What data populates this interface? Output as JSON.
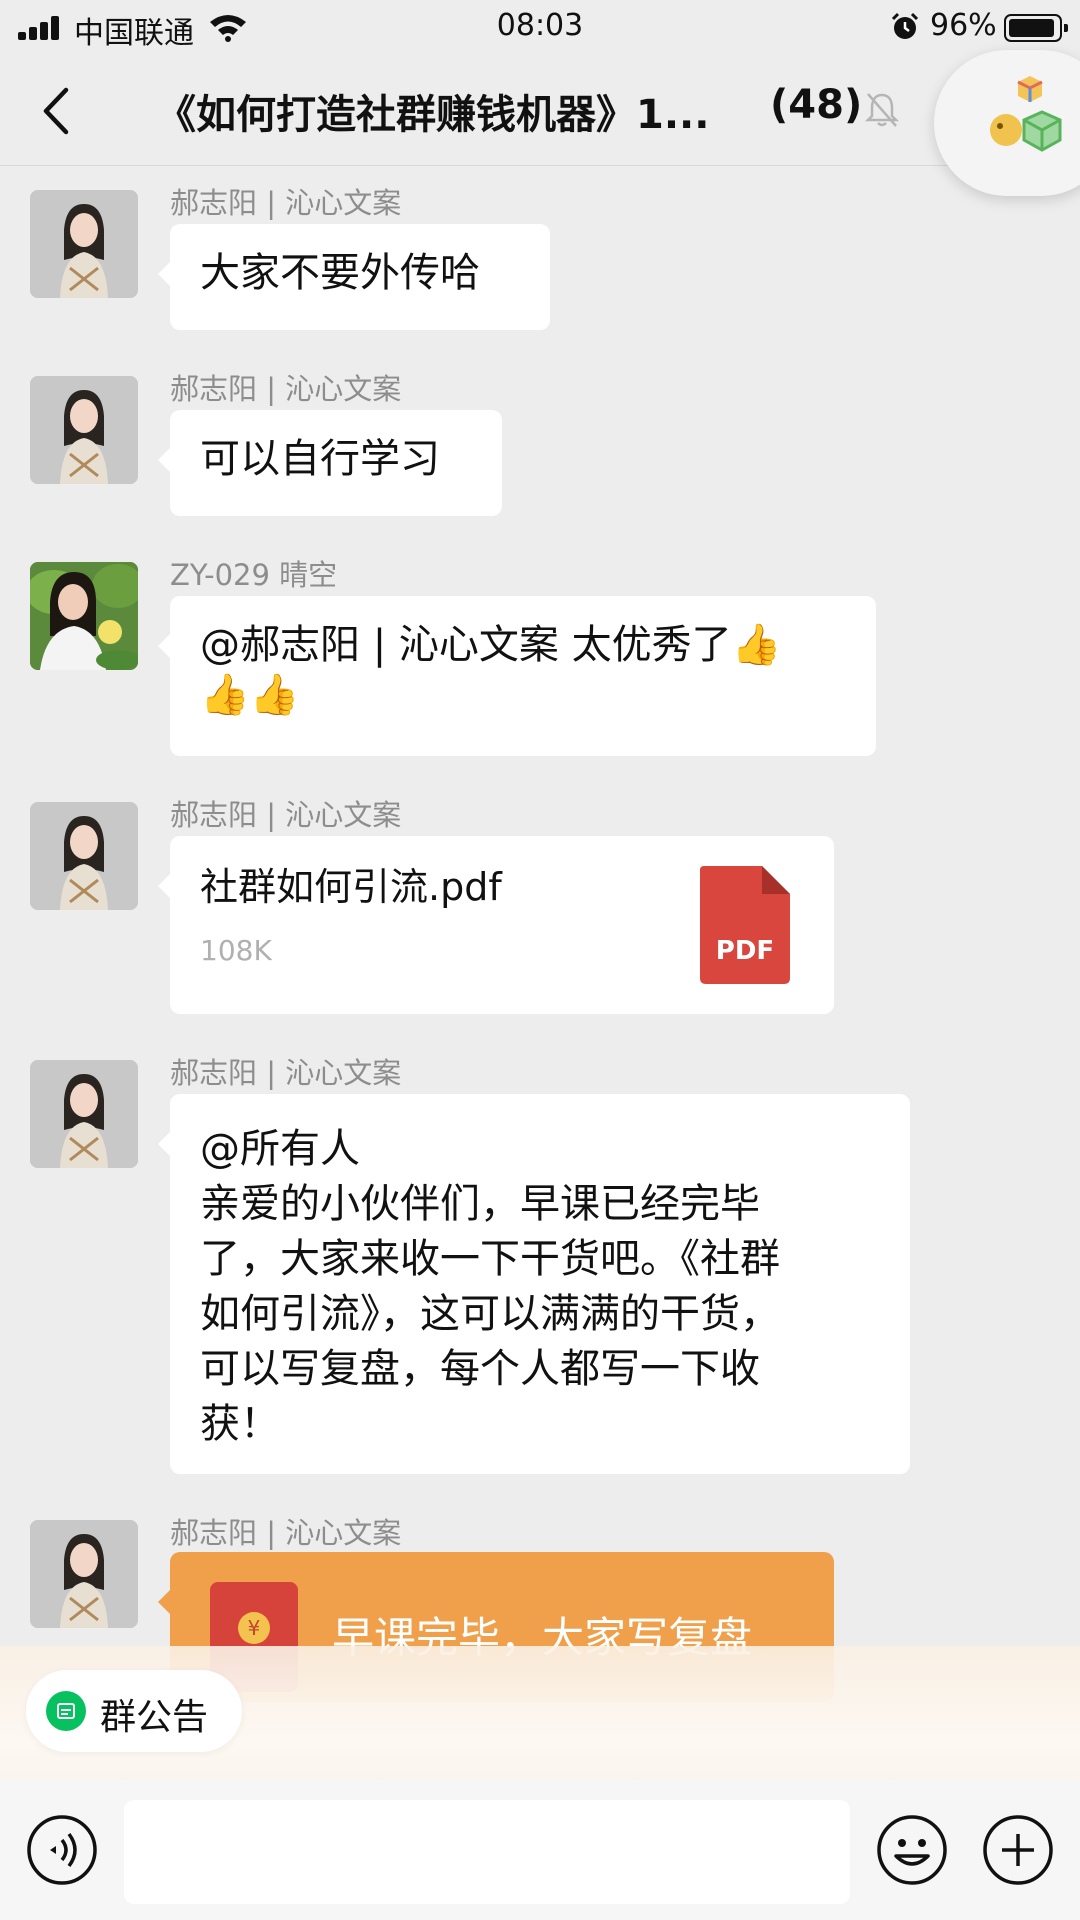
{
  "status_bar": {
    "carrier": "中国联通",
    "time": "08:03",
    "battery": "96%"
  },
  "nav": {
    "title": "《如何打造社群赚钱机器》1...",
    "member_count": "(48)"
  },
  "messages": [
    {
      "sender": "郝志阳 | 沁心文案",
      "text": "大家不要外传哈"
    },
    {
      "sender": "郝志阳 | 沁心文案",
      "text": "可以自行学习"
    },
    {
      "sender": "ZY-029 晴空",
      "text": "@郝志阳 | 沁心文案 太优秀了",
      "emoji": "👍"
    },
    {
      "sender": "郝志阳 | 沁心文案",
      "file": {
        "name": "社群如何引流.pdf",
        "size": "108K",
        "type": "PDF"
      }
    },
    {
      "sender": "郝志阳 | 沁心文案",
      "lines": [
        "@所有人",
        "亲爱的小伙伴们，早课已经完毕",
        "了，大家来收一下干货吧。《社群",
        "如何引流》，这可以满满的干货，",
        "可以写复盘，每个人都写一下收",
        "获！"
      ]
    },
    {
      "sender": "郝志阳 | 沁心文案",
      "red_packet": {
        "text": "早课完毕，大家写复盘"
      }
    }
  ],
  "group_notice": {
    "label": "群公告"
  },
  "input": {
    "placeholder": ""
  },
  "colors": {
    "background": "#ededed",
    "bubble": "#ffffff",
    "red_packet": "#f0a04a",
    "pdf": "#d9463d",
    "wechat_green": "#07c160"
  }
}
